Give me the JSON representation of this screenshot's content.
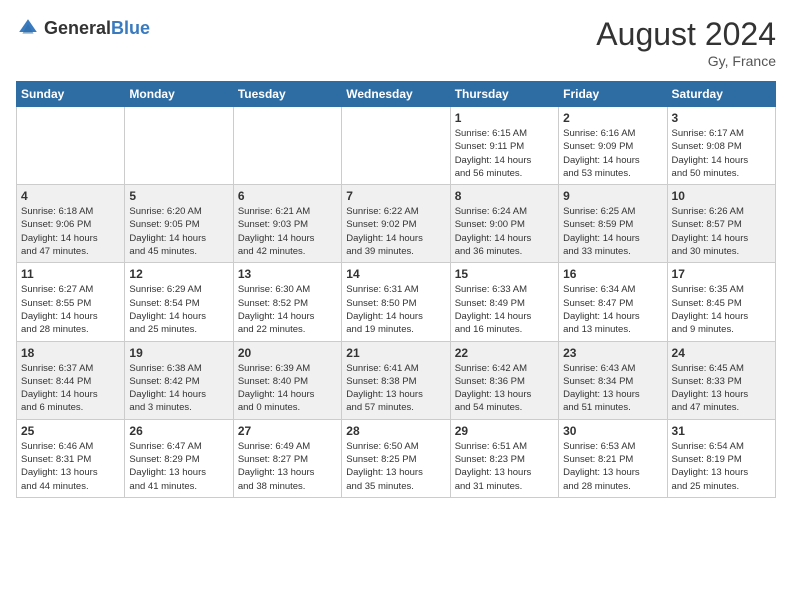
{
  "header": {
    "logo_general": "General",
    "logo_blue": "Blue",
    "month_year": "August 2024",
    "location": "Gy, France"
  },
  "days_of_week": [
    "Sunday",
    "Monday",
    "Tuesday",
    "Wednesday",
    "Thursday",
    "Friday",
    "Saturday"
  ],
  "weeks": [
    [
      {
        "day": "",
        "info": ""
      },
      {
        "day": "",
        "info": ""
      },
      {
        "day": "",
        "info": ""
      },
      {
        "day": "",
        "info": ""
      },
      {
        "day": "1",
        "info": "Sunrise: 6:15 AM\nSunset: 9:11 PM\nDaylight: 14 hours\nand 56 minutes."
      },
      {
        "day": "2",
        "info": "Sunrise: 6:16 AM\nSunset: 9:09 PM\nDaylight: 14 hours\nand 53 minutes."
      },
      {
        "day": "3",
        "info": "Sunrise: 6:17 AM\nSunset: 9:08 PM\nDaylight: 14 hours\nand 50 minutes."
      }
    ],
    [
      {
        "day": "4",
        "info": "Sunrise: 6:18 AM\nSunset: 9:06 PM\nDaylight: 14 hours\nand 47 minutes."
      },
      {
        "day": "5",
        "info": "Sunrise: 6:20 AM\nSunset: 9:05 PM\nDaylight: 14 hours\nand 45 minutes."
      },
      {
        "day": "6",
        "info": "Sunrise: 6:21 AM\nSunset: 9:03 PM\nDaylight: 14 hours\nand 42 minutes."
      },
      {
        "day": "7",
        "info": "Sunrise: 6:22 AM\nSunset: 9:02 PM\nDaylight: 14 hours\nand 39 minutes."
      },
      {
        "day": "8",
        "info": "Sunrise: 6:24 AM\nSunset: 9:00 PM\nDaylight: 14 hours\nand 36 minutes."
      },
      {
        "day": "9",
        "info": "Sunrise: 6:25 AM\nSunset: 8:59 PM\nDaylight: 14 hours\nand 33 minutes."
      },
      {
        "day": "10",
        "info": "Sunrise: 6:26 AM\nSunset: 8:57 PM\nDaylight: 14 hours\nand 30 minutes."
      }
    ],
    [
      {
        "day": "11",
        "info": "Sunrise: 6:27 AM\nSunset: 8:55 PM\nDaylight: 14 hours\nand 28 minutes."
      },
      {
        "day": "12",
        "info": "Sunrise: 6:29 AM\nSunset: 8:54 PM\nDaylight: 14 hours\nand 25 minutes."
      },
      {
        "day": "13",
        "info": "Sunrise: 6:30 AM\nSunset: 8:52 PM\nDaylight: 14 hours\nand 22 minutes."
      },
      {
        "day": "14",
        "info": "Sunrise: 6:31 AM\nSunset: 8:50 PM\nDaylight: 14 hours\nand 19 minutes."
      },
      {
        "day": "15",
        "info": "Sunrise: 6:33 AM\nSunset: 8:49 PM\nDaylight: 14 hours\nand 16 minutes."
      },
      {
        "day": "16",
        "info": "Sunrise: 6:34 AM\nSunset: 8:47 PM\nDaylight: 14 hours\nand 13 minutes."
      },
      {
        "day": "17",
        "info": "Sunrise: 6:35 AM\nSunset: 8:45 PM\nDaylight: 14 hours\nand 9 minutes."
      }
    ],
    [
      {
        "day": "18",
        "info": "Sunrise: 6:37 AM\nSunset: 8:44 PM\nDaylight: 14 hours\nand 6 minutes."
      },
      {
        "day": "19",
        "info": "Sunrise: 6:38 AM\nSunset: 8:42 PM\nDaylight: 14 hours\nand 3 minutes."
      },
      {
        "day": "20",
        "info": "Sunrise: 6:39 AM\nSunset: 8:40 PM\nDaylight: 14 hours\nand 0 minutes."
      },
      {
        "day": "21",
        "info": "Sunrise: 6:41 AM\nSunset: 8:38 PM\nDaylight: 13 hours\nand 57 minutes."
      },
      {
        "day": "22",
        "info": "Sunrise: 6:42 AM\nSunset: 8:36 PM\nDaylight: 13 hours\nand 54 minutes."
      },
      {
        "day": "23",
        "info": "Sunrise: 6:43 AM\nSunset: 8:34 PM\nDaylight: 13 hours\nand 51 minutes."
      },
      {
        "day": "24",
        "info": "Sunrise: 6:45 AM\nSunset: 8:33 PM\nDaylight: 13 hours\nand 47 minutes."
      }
    ],
    [
      {
        "day": "25",
        "info": "Sunrise: 6:46 AM\nSunset: 8:31 PM\nDaylight: 13 hours\nand 44 minutes."
      },
      {
        "day": "26",
        "info": "Sunrise: 6:47 AM\nSunset: 8:29 PM\nDaylight: 13 hours\nand 41 minutes."
      },
      {
        "day": "27",
        "info": "Sunrise: 6:49 AM\nSunset: 8:27 PM\nDaylight: 13 hours\nand 38 minutes."
      },
      {
        "day": "28",
        "info": "Sunrise: 6:50 AM\nSunset: 8:25 PM\nDaylight: 13 hours\nand 35 minutes."
      },
      {
        "day": "29",
        "info": "Sunrise: 6:51 AM\nSunset: 8:23 PM\nDaylight: 13 hours\nand 31 minutes."
      },
      {
        "day": "30",
        "info": "Sunrise: 6:53 AM\nSunset: 8:21 PM\nDaylight: 13 hours\nand 28 minutes."
      },
      {
        "day": "31",
        "info": "Sunrise: 6:54 AM\nSunset: 8:19 PM\nDaylight: 13 hours\nand 25 minutes."
      }
    ]
  ]
}
